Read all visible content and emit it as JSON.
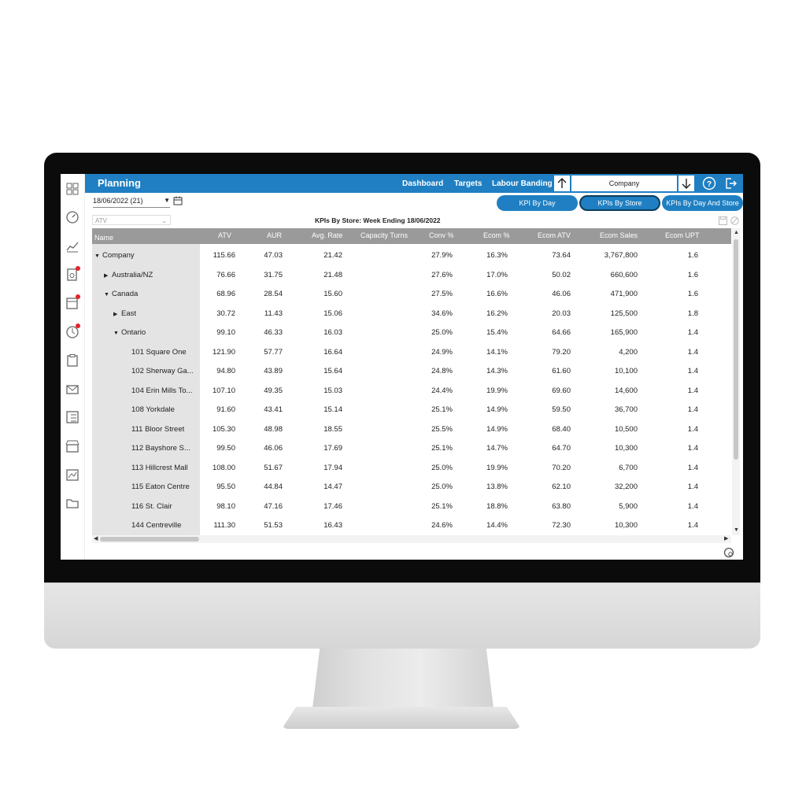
{
  "app": {
    "title": "Planning",
    "nav": [
      "Dashboard",
      "Targets",
      "Labour Banding"
    ],
    "hierarchy_selector": "Company",
    "date_selector": "18/06/2022 (21)",
    "metric_selector": "ATV",
    "view_buttons": [
      "KPI By Day",
      "KPIs By Store",
      "KPIs By Day And Store"
    ],
    "active_view": "KPIs By Store",
    "table_title": "KPIs By Store: Week Ending 18/06/2022"
  },
  "icons": {
    "rail": [
      "dashboard-grid-icon",
      "gauge-icon",
      "chart-icon",
      "report-alert-icon",
      "calendar-alert-icon",
      "clock-alert-icon",
      "clipboard-icon",
      "envelope-icon",
      "checklist-icon",
      "store-icon",
      "data-chart-icon",
      "folder-icon"
    ],
    "accent": "#1f7fc2",
    "alert": "#e5222a"
  },
  "table": {
    "columns": [
      "Name",
      "ATV",
      "AUR",
      "Avg. Rate",
      "Capacity Turns",
      "Conv %",
      "Ecom %",
      "Ecom ATV",
      "Ecom Sales",
      "Ecom UPT"
    ],
    "rows": [
      {
        "name": "Company",
        "expand": "▼",
        "level": 0,
        "atv": "115.66",
        "aur": "47.03",
        "rate": "21.42",
        "turns": "",
        "conv": "27.9%",
        "ecom": "16.3%",
        "eatv": "73.64",
        "esales": "3,767,800",
        "eupt": "1.6"
      },
      {
        "name": "Australia/NZ",
        "expand": "▶",
        "level": 1,
        "atv": "76.66",
        "aur": "31.75",
        "rate": "21.48",
        "turns": "",
        "conv": "27.6%",
        "ecom": "17.0%",
        "eatv": "50.02",
        "esales": "660,600",
        "eupt": "1.6"
      },
      {
        "name": "Canada",
        "expand": "▼",
        "level": 1,
        "atv": "68.96",
        "aur": "28.54",
        "rate": "15.60",
        "turns": "",
        "conv": "27.5%",
        "ecom": "16.6%",
        "eatv": "46.06",
        "esales": "471,900",
        "eupt": "1.6"
      },
      {
        "name": "East",
        "expand": "▶",
        "level": 2,
        "atv": "30.72",
        "aur": "11.43",
        "rate": "15.06",
        "turns": "",
        "conv": "34.6%",
        "ecom": "16.2%",
        "eatv": "20.03",
        "esales": "125,500",
        "eupt": "1.8"
      },
      {
        "name": "Ontario",
        "expand": "▼",
        "level": 2,
        "atv": "99.10",
        "aur": "46.33",
        "rate": "16.03",
        "turns": "",
        "conv": "25.0%",
        "ecom": "15.4%",
        "eatv": "64.66",
        "esales": "165,900",
        "eupt": "1.4"
      },
      {
        "name": "101 Square One",
        "expand": "",
        "level": 3,
        "atv": "121.90",
        "aur": "57.77",
        "rate": "16.64",
        "turns": "",
        "conv": "24.9%",
        "ecom": "14.1%",
        "eatv": "79.20",
        "esales": "4,200",
        "eupt": "1.4"
      },
      {
        "name": "102 Sherway Ga...",
        "expand": "",
        "level": 3,
        "atv": "94.80",
        "aur": "43.89",
        "rate": "15.64",
        "turns": "",
        "conv": "24.8%",
        "ecom": "14.3%",
        "eatv": "61.60",
        "esales": "10,100",
        "eupt": "1.4"
      },
      {
        "name": "104 Erin Mills To...",
        "expand": "",
        "level": 3,
        "atv": "107.10",
        "aur": "49.35",
        "rate": "15.03",
        "turns": "",
        "conv": "24.4%",
        "ecom": "19.9%",
        "eatv": "69.60",
        "esales": "14,600",
        "eupt": "1.4"
      },
      {
        "name": "108 Yorkdale",
        "expand": "",
        "level": 3,
        "atv": "91.60",
        "aur": "43.41",
        "rate": "15.14",
        "turns": "",
        "conv": "25.1%",
        "ecom": "14.9%",
        "eatv": "59.50",
        "esales": "36,700",
        "eupt": "1.4"
      },
      {
        "name": "111 Bloor Street",
        "expand": "",
        "level": 3,
        "atv": "105.30",
        "aur": "48.98",
        "rate": "18.55",
        "turns": "",
        "conv": "25.5%",
        "ecom": "14.9%",
        "eatv": "68.40",
        "esales": "10,500",
        "eupt": "1.4"
      },
      {
        "name": "112 Bayshore S...",
        "expand": "",
        "level": 3,
        "atv": "99.50",
        "aur": "46.06",
        "rate": "17.69",
        "turns": "",
        "conv": "25.1%",
        "ecom": "14.7%",
        "eatv": "64.70",
        "esales": "10,300",
        "eupt": "1.4"
      },
      {
        "name": "113 Hillcrest Mall",
        "expand": "",
        "level": 3,
        "atv": "108.00",
        "aur": "51.67",
        "rate": "17.94",
        "turns": "",
        "conv": "25.0%",
        "ecom": "19.9%",
        "eatv": "70.20",
        "esales": "6,700",
        "eupt": "1.4"
      },
      {
        "name": "115 Eaton Centre",
        "expand": "",
        "level": 3,
        "atv": "95.50",
        "aur": "44.84",
        "rate": "14.47",
        "turns": "",
        "conv": "25.0%",
        "ecom": "13.8%",
        "eatv": "62.10",
        "esales": "32,200",
        "eupt": "1.4"
      },
      {
        "name": "116 St. Clair",
        "expand": "",
        "level": 3,
        "atv": "98.10",
        "aur": "47.16",
        "rate": "17.46",
        "turns": "",
        "conv": "25.1%",
        "ecom": "18.8%",
        "eatv": "63.80",
        "esales": "5,900",
        "eupt": "1.4"
      },
      {
        "name": "144 Centreville",
        "expand": "",
        "level": 3,
        "atv": "111.30",
        "aur": "51.53",
        "rate": "16.43",
        "turns": "",
        "conv": "24.6%",
        "ecom": "14.4%",
        "eatv": "72.30",
        "esales": "10,300",
        "eupt": "1.4"
      }
    ]
  }
}
